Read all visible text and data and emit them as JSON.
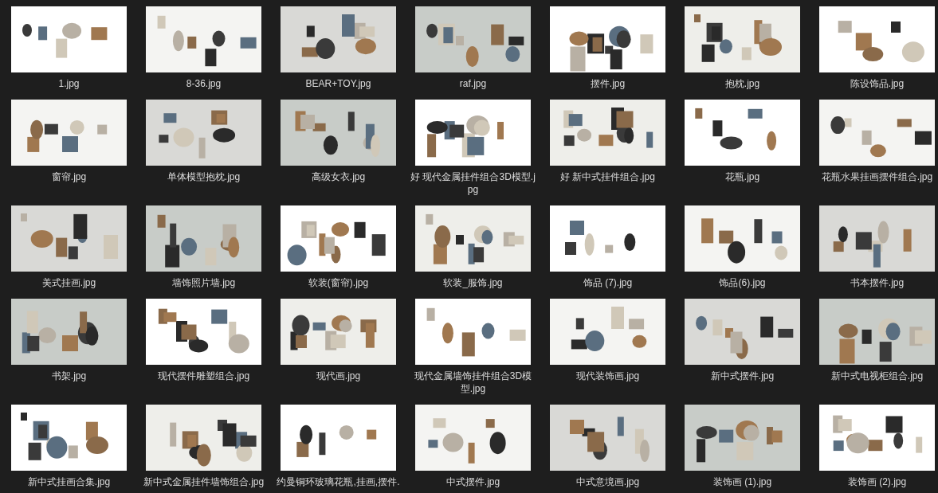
{
  "files": [
    {
      "name": "1.jpg"
    },
    {
      "name": "8-36.jpg"
    },
    {
      "name": "BEAR+TOY.jpg"
    },
    {
      "name": "raf.jpg"
    },
    {
      "name": "摆件.jpg"
    },
    {
      "name": "抱枕.jpg"
    },
    {
      "name": "陈设饰品.jpg"
    },
    {
      "name": "窗帘.jpg"
    },
    {
      "name": "单体模型抱枕.jpg"
    },
    {
      "name": "高级女衣.jpg"
    },
    {
      "name": "好 现代金属挂件组合3D模型.jpg"
    },
    {
      "name": "好 新中式挂件组合.jpg"
    },
    {
      "name": "花瓶.jpg"
    },
    {
      "name": "花瓶水果挂画摆件组合.jpg"
    },
    {
      "name": "美式挂画.jpg"
    },
    {
      "name": "墙饰照片墙.jpg"
    },
    {
      "name": "软装(窗帘).jpg"
    },
    {
      "name": "软装_服饰.jpg"
    },
    {
      "name": "饰品 (7).jpg"
    },
    {
      "name": "饰品(6).jpg"
    },
    {
      "name": "书本摆件.jpg"
    },
    {
      "name": "书架.jpg"
    },
    {
      "name": "现代摆件雕塑组合.jpg"
    },
    {
      "name": "现代画.jpg"
    },
    {
      "name": "现代金属墙饰挂件组合3D模型.jpg"
    },
    {
      "name": "现代装饰画.jpg"
    },
    {
      "name": "新中式摆件.jpg"
    },
    {
      "name": "新中式电视柜组合.jpg"
    },
    {
      "name": "新中式挂画合集.jpg"
    },
    {
      "name": "新中式金属挂件墙饰组合.jpg"
    },
    {
      "name": "约曼铜环玻璃花瓶,挂画,摆件."
    },
    {
      "name": "中式摆件.jpg"
    },
    {
      "name": "中式意境画.jpg"
    },
    {
      "name": "装饰画 (1).jpg"
    },
    {
      "name": "装饰画 (2).jpg"
    }
  ]
}
